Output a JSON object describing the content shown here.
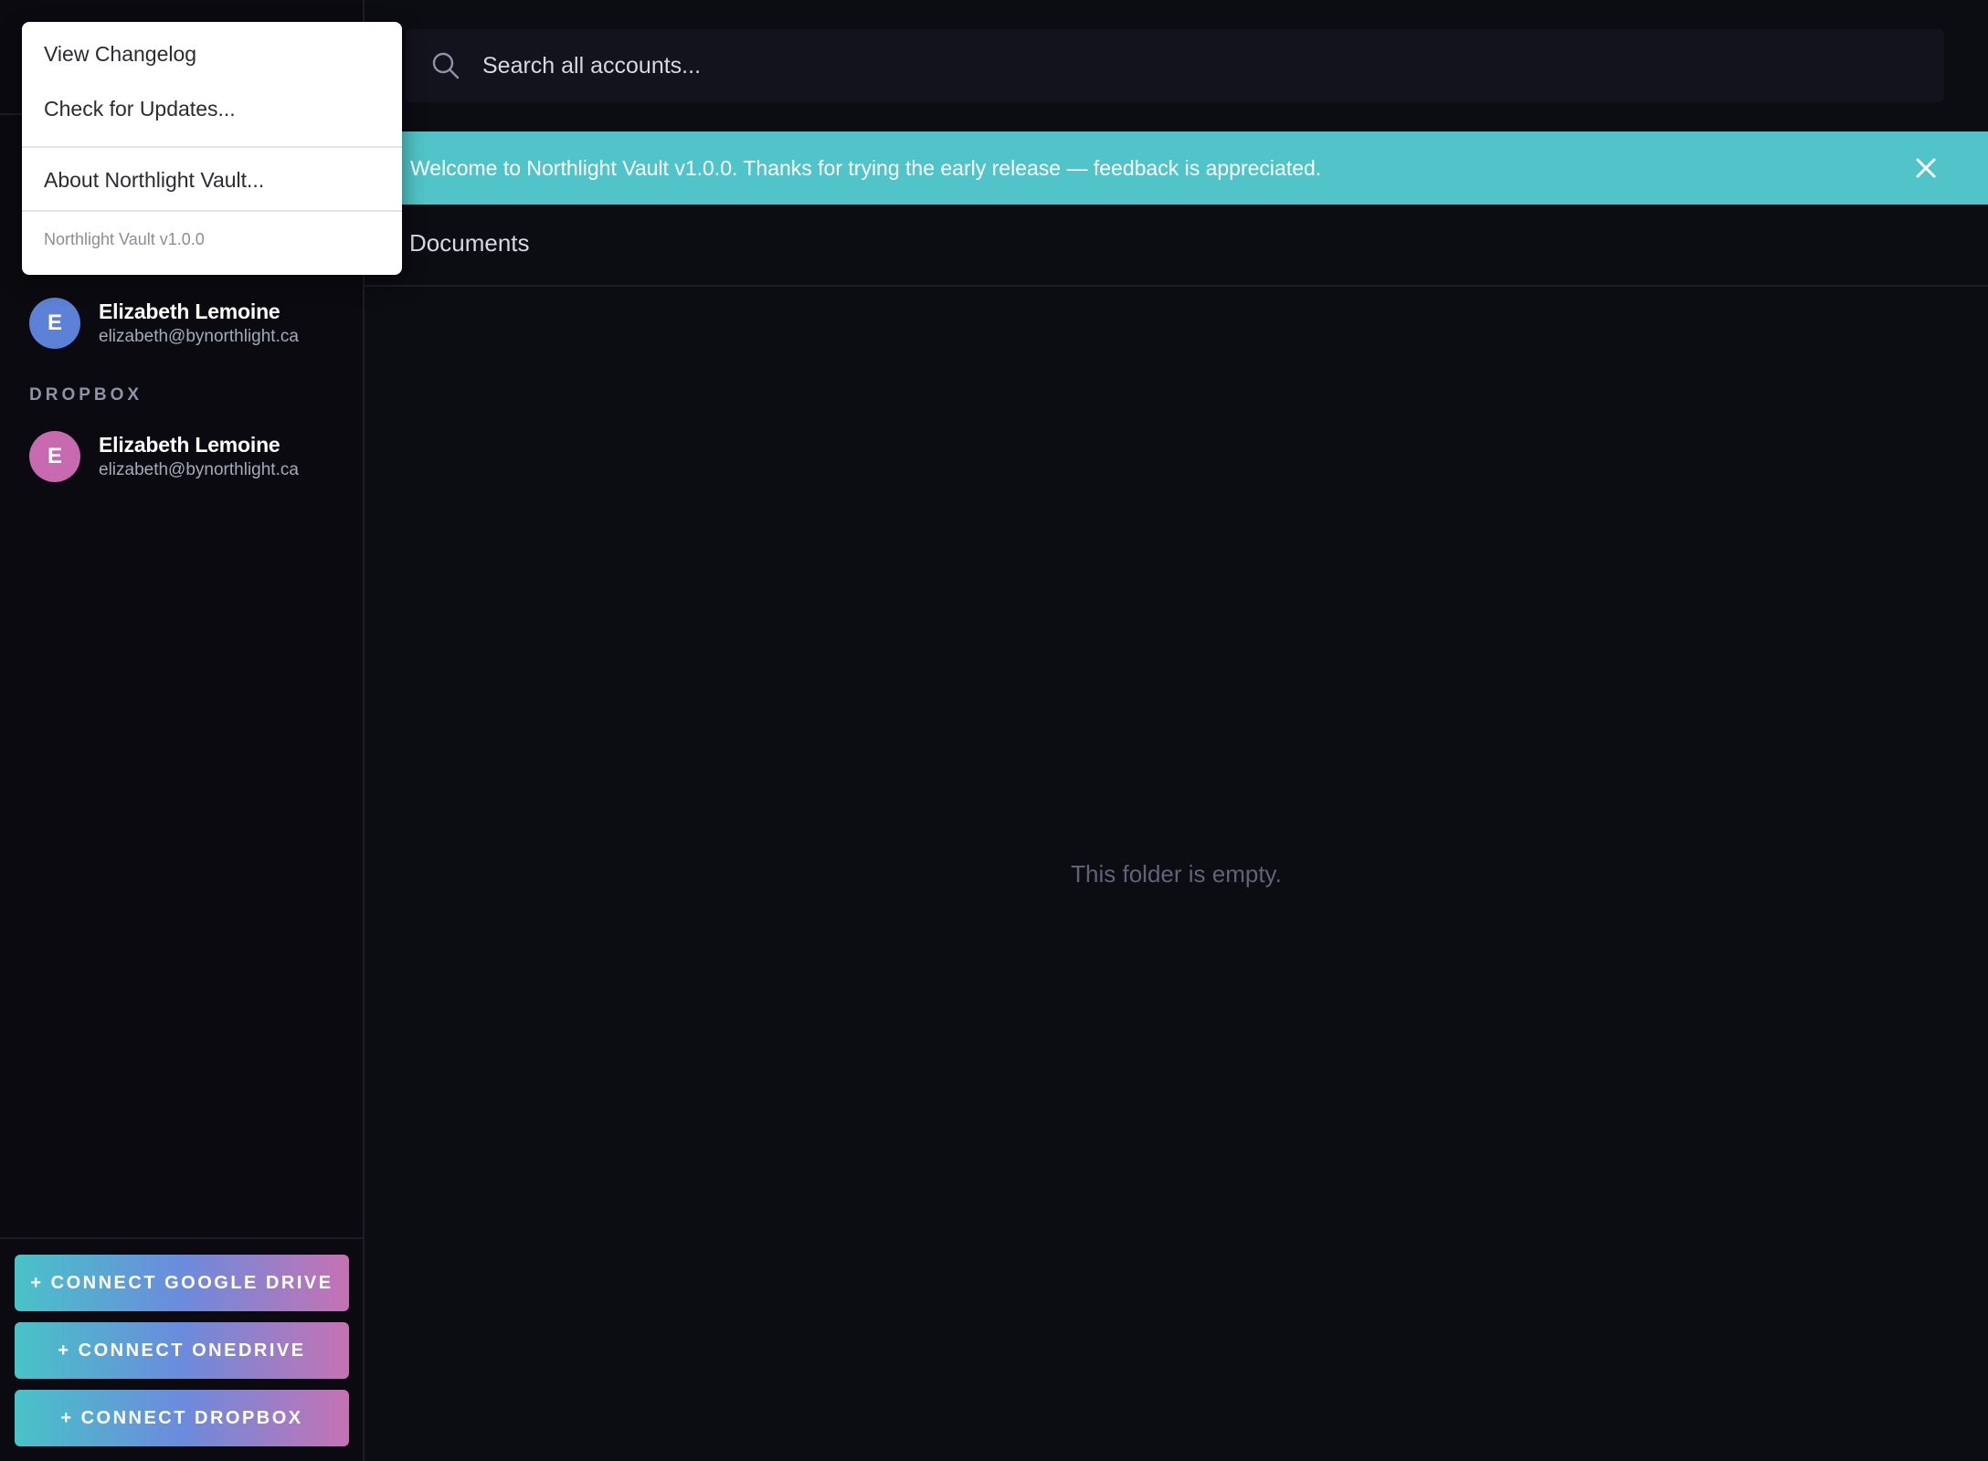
{
  "menu": {
    "items": [
      {
        "label": "View Changelog"
      },
      {
        "label": "Check for Updates..."
      },
      {
        "label": "About Northlight Vault..."
      }
    ],
    "version": "Northlight Vault v1.0.0"
  },
  "search": {
    "placeholder": "Search all accounts..."
  },
  "banner": {
    "message": "Welcome to Northlight Vault v1.0.0. Thanks for trying the early release — feedback is appreciated.",
    "color": "#50c4c8"
  },
  "sidebar": {
    "accounts_first": {
      "initial": "E",
      "name": "Elizabeth Lemoine",
      "email": "elizabeth@bynorthlight.ca",
      "avatar_color": "#5b82d6"
    },
    "dropbox_section": {
      "label": "DROPBOX",
      "account": {
        "initial": "E",
        "name": "Elizabeth Lemoine",
        "email": "elizabeth@bynorthlight.ca",
        "avatar_color": "#c86aaf"
      }
    },
    "connect_buttons": [
      {
        "label": "+ CONNECT GOOGLE DRIVE"
      },
      {
        "label": "+ CONNECT ONEDRIVE"
      },
      {
        "label": "+ CONNECT DROPBOX"
      }
    ]
  },
  "main": {
    "breadcrumb": "Documents",
    "empty_message": "This folder is empty."
  }
}
